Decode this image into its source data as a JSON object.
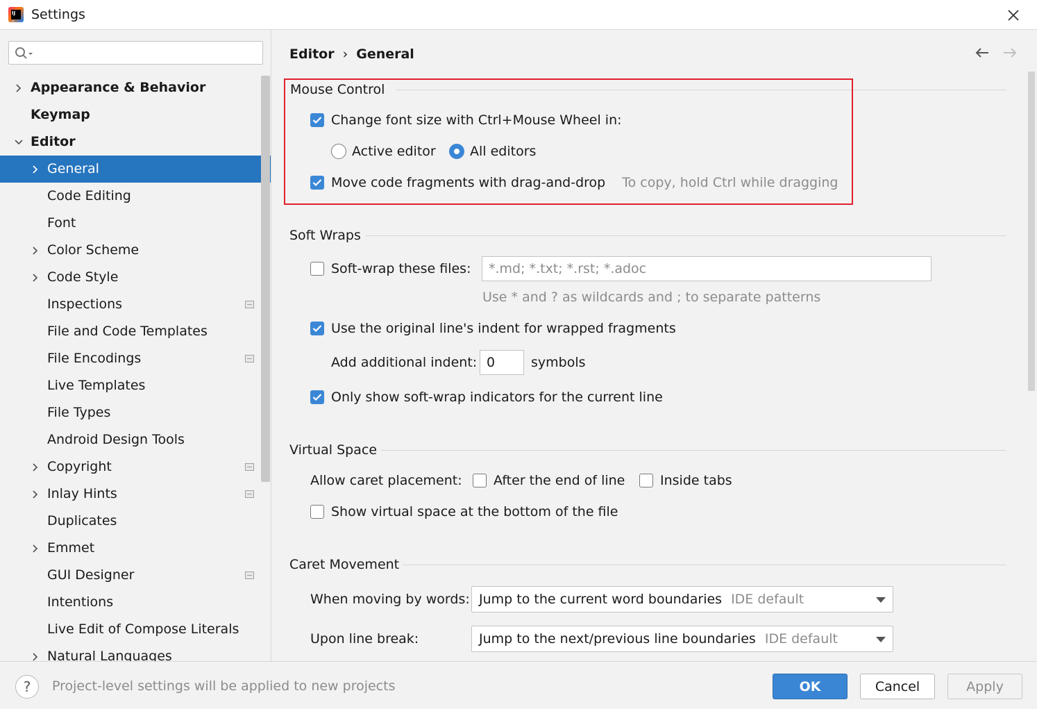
{
  "window": {
    "title": "Settings"
  },
  "search": {
    "value": "",
    "placeholder": ""
  },
  "sidebar": {
    "items": [
      {
        "label": "Appearance & Behavior",
        "expander": "collapsed",
        "bold": true
      },
      {
        "label": "Keymap",
        "bold": true
      },
      {
        "label": "Editor",
        "expander": "expanded",
        "bold": true
      },
      {
        "label": "General",
        "expander": "collapsed",
        "selected": true
      },
      {
        "label": "Code Editing"
      },
      {
        "label": "Font"
      },
      {
        "label": "Color Scheme",
        "expander": "collapsed"
      },
      {
        "label": "Code Style",
        "expander": "collapsed"
      },
      {
        "label": "Inspections",
        "project_icon": true
      },
      {
        "label": "File and Code Templates"
      },
      {
        "label": "File Encodings",
        "project_icon": true
      },
      {
        "label": "Live Templates"
      },
      {
        "label": "File Types"
      },
      {
        "label": "Android Design Tools"
      },
      {
        "label": "Copyright",
        "expander": "collapsed",
        "project_icon": true
      },
      {
        "label": "Inlay Hints",
        "expander": "collapsed",
        "project_icon": true
      },
      {
        "label": "Duplicates"
      },
      {
        "label": "Emmet",
        "expander": "collapsed"
      },
      {
        "label": "GUI Designer",
        "project_icon": true
      },
      {
        "label": "Intentions"
      },
      {
        "label": "Live Edit of Compose Literals"
      },
      {
        "label": "Natural Languages",
        "expander": "collapsed"
      }
    ]
  },
  "breadcrumb": {
    "parent": "Editor",
    "separator": "›",
    "current": "General"
  },
  "mouse_control": {
    "title": "Mouse Control",
    "font_size_wheel": {
      "label": "Change font size with Ctrl+Mouse Wheel in:",
      "checked": true
    },
    "radio_active": {
      "label": "Active editor",
      "selected": false
    },
    "radio_all": {
      "label": "All editors",
      "selected": true
    },
    "drag_drop": {
      "label": "Move code fragments with drag-and-drop",
      "checked": true,
      "hint": "To copy, hold Ctrl while dragging"
    }
  },
  "soft_wraps": {
    "title": "Soft Wraps",
    "wrap_files": {
      "label": "Soft-wrap these files:",
      "checked": false,
      "value": "*.md; *.txt; *.rst; *.adoc"
    },
    "wildcards_hint": "Use * and ? as wildcards and ; to separate patterns",
    "original_indent": {
      "label": "Use the original line's indent for wrapped fragments",
      "checked": true
    },
    "additional_indent": {
      "label": "Add additional indent:",
      "value": "0",
      "suffix": "symbols"
    },
    "indicators": {
      "label": "Only show soft-wrap indicators for the current line",
      "checked": true
    }
  },
  "virtual_space": {
    "title": "Virtual Space",
    "caret_label": "Allow caret placement:",
    "after_end": {
      "label": "After the end of line",
      "checked": false
    },
    "inside_tabs": {
      "label": "Inside tabs",
      "checked": false
    },
    "bottom": {
      "label": "Show virtual space at the bottom of the file",
      "checked": false
    }
  },
  "caret_movement": {
    "title": "Caret Movement",
    "words": {
      "label": "When moving by words:",
      "value": "Jump to the current word boundaries",
      "hint": "IDE default"
    },
    "line_break": {
      "label": "Upon line break:",
      "value": "Jump to the next/previous line boundaries",
      "hint": "IDE default"
    }
  },
  "footer": {
    "help": "?",
    "note": "Project-level settings will be applied to new projects",
    "ok": "OK",
    "cancel": "Cancel",
    "apply": "Apply"
  },
  "colors": {
    "selection": "#2675bf",
    "accent": "#3b87d6",
    "highlight_border": "#e0202c"
  }
}
